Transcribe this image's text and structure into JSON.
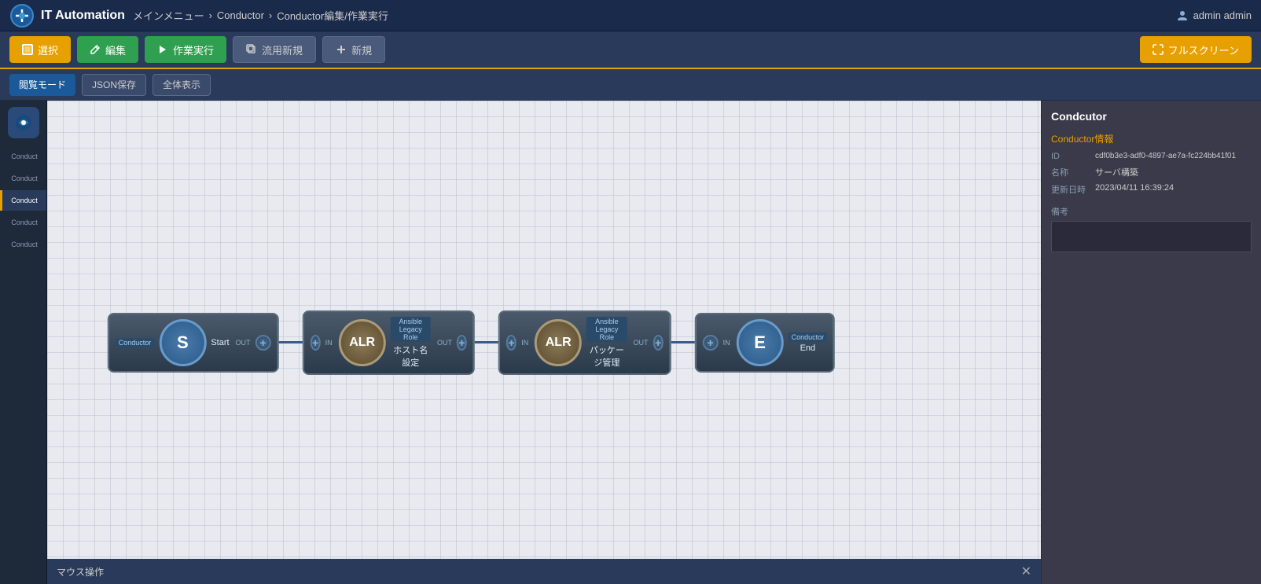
{
  "header": {
    "app_name": "IT Automation",
    "breadcrumb": {
      "menu": "メインメニュー",
      "sep1": "›",
      "section": "Conductor",
      "sep2": "›",
      "page": "Conductor編集/作業実行"
    },
    "user": "admin admin"
  },
  "toolbar": {
    "select_label": "選択",
    "edit_label": "編集",
    "run_label": "作業実行",
    "copy_label": "流用新規",
    "new_label": "新規",
    "fullscreen_label": "フルスクリーン"
  },
  "secondary_toolbar": {
    "mode_label": "閲覧モード",
    "json_label": "JSON保存",
    "view_all_label": "全体表示"
  },
  "sidebar": {
    "items": [
      {
        "label": "Conduct"
      },
      {
        "label": "Conduct"
      },
      {
        "label": "Conduct"
      },
      {
        "label": "Conduct"
      },
      {
        "label": "Conduct"
      }
    ]
  },
  "canvas": {
    "nodes": [
      {
        "id": "start",
        "type": "Conductor",
        "circle_text": "S",
        "name": "Start",
        "has_in": false,
        "has_out": true
      },
      {
        "id": "alr1",
        "type": "Ansible Legacy Role",
        "circle_text": "ALR",
        "name": "ホスト名設定",
        "has_in": true,
        "has_out": true
      },
      {
        "id": "alr2",
        "type": "Ansible Legacy Role",
        "circle_text": "ALR",
        "name": "パッケージ管理",
        "has_in": true,
        "has_out": true
      },
      {
        "id": "end",
        "type": "Conductor",
        "circle_text": "E",
        "name": "End",
        "has_in": true,
        "has_out": false
      }
    ],
    "in_label": "IN",
    "out_label": "OUT"
  },
  "right_panel": {
    "title": "Condcutor",
    "section_title": "Conductor情報",
    "id_label": "ID",
    "id_value": "cdf0b3e3-adf0-4897-ae7a-fc224bb41f01",
    "name_label": "名称",
    "name_value": "サーバ構築",
    "date_label": "更新日時",
    "date_value": "2023/04/11 16:39:24",
    "remarks_label": "備考"
  },
  "mouse_hint": {
    "label": "マウス操作"
  }
}
